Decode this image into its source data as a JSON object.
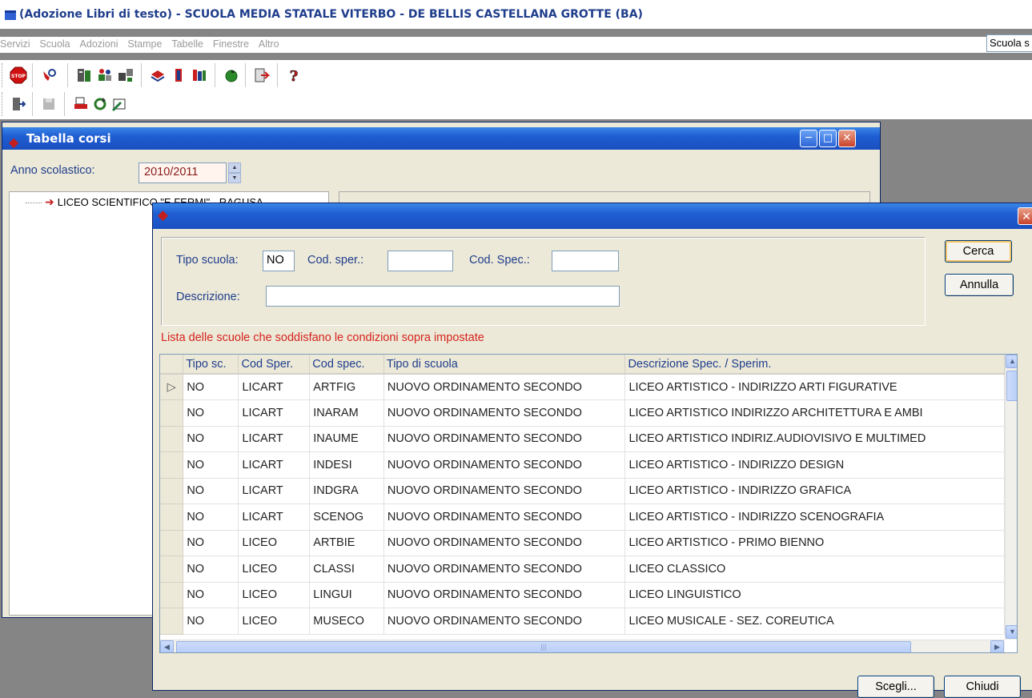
{
  "app": {
    "title": "(Adozione Libri di testo) - SCUOLA MEDIA STATALE VITERBO - DE BELLIS CASTELLANA GROTTE (BA)",
    "menu": [
      "Servizi",
      "Scuola",
      "Adozioni",
      "Stampe",
      "Tabelle",
      "Finestre",
      "Altro"
    ],
    "school_select": "Scuola s"
  },
  "toolbar1": [
    "stop-icon",
    "tools-icon",
    "book-cards-icon",
    "people-icon",
    "network-icon",
    "books-icon",
    "book-icon",
    "bookshelf-icon",
    "refresh-icon",
    "export-icon",
    "help-icon"
  ],
  "toolbar2": [
    "exit-icon",
    "save-icon",
    "print-icon",
    "sync-icon",
    "edit-icon"
  ],
  "corsi_window": {
    "title": "Tabella corsi",
    "anno_label": "Anno scolastico:",
    "anno_value": "2010/2011",
    "tree_item": "LICEO SCIENTIFICO \"E.FERMI\" - RAGUSA"
  },
  "dialog": {
    "tipo_label": "Tipo scuola:",
    "tipo_value": "NO",
    "codsper_label": "Cod. sper.:",
    "codsper_value": "",
    "codspec_label": "Cod. Spec.:",
    "codspec_value": "",
    "descr_label": "Descrizione:",
    "descr_value": "",
    "cerca": "Cerca",
    "annulla": "Annulla",
    "caption": "Lista delle scuole che soddisfano le condizioni sopra impostate",
    "bottom_buttons": [
      "Scegli...",
      "Chiudi"
    ]
  },
  "grid": {
    "columns": [
      "Tipo sc.",
      "Cod Sper.",
      "Cod spec.",
      "Tipo di scuola",
      "Descrizione Spec. / Sperim."
    ],
    "rows": [
      [
        "NO",
        "LICART",
        "ARTFIG",
        "NUOVO ORDINAMENTO SECONDO",
        "LICEO ARTISTICO - INDIRIZZO ARTI FIGURATIVE"
      ],
      [
        "NO",
        "LICART",
        "INARAM",
        "NUOVO ORDINAMENTO SECONDO",
        "LICEO ARTISTICO INDIRIZZO ARCHITETTURA E AMBI"
      ],
      [
        "NO",
        "LICART",
        "INAUME",
        "NUOVO ORDINAMENTO SECONDO",
        "LICEO ARTISTICO INDIRIZ.AUDIOVISIVO E MULTIMED"
      ],
      [
        "NO",
        "LICART",
        "INDESI",
        "NUOVO ORDINAMENTO SECONDO",
        "LICEO ARTISTICO - INDIRIZZO DESIGN"
      ],
      [
        "NO",
        "LICART",
        "INDGRA",
        "NUOVO ORDINAMENTO SECONDO",
        "LICEO ARTISTICO - INDIRIZZO GRAFICA"
      ],
      [
        "NO",
        "LICART",
        "SCENOG",
        "NUOVO ORDINAMENTO SECONDO",
        "LICEO ARTISTICO - INDIRIZZO SCENOGRAFIA"
      ],
      [
        "NO",
        "LICEO",
        "ARTBIE",
        "NUOVO ORDINAMENTO SECONDO",
        "LICEO ARTISTICO - PRIMO BIENNO"
      ],
      [
        "NO",
        "LICEO",
        "CLASSI",
        "NUOVO ORDINAMENTO SECONDO",
        "LICEO CLASSICO"
      ],
      [
        "NO",
        "LICEO",
        "LINGUI",
        "NUOVO ORDINAMENTO SECONDO",
        "LICEO LINGUISTICO"
      ],
      [
        "NO",
        "LICEO",
        "MUSECO",
        "NUOVO ORDINAMENTO SECONDO",
        "LICEO MUSICALE - SEZ. COREUTICA"
      ]
    ],
    "selected_row": 0
  }
}
